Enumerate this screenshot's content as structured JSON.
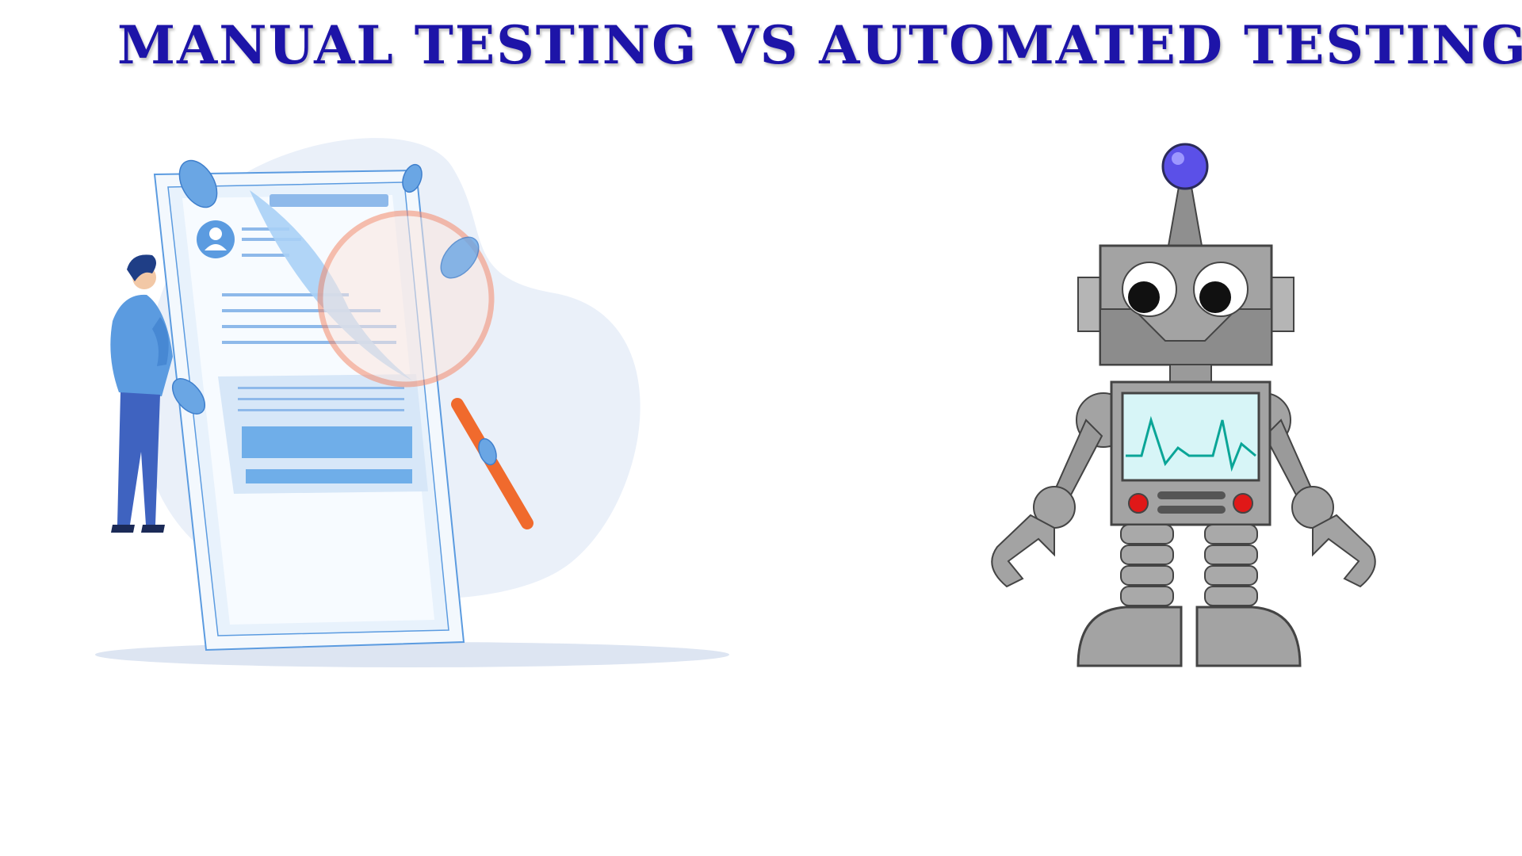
{
  "title": "MANUAL TESTING VS AUTOMATED TESTING",
  "colors": {
    "title": "#1d14a8",
    "manual_blue": "#5b9be0",
    "magnifier_orange": "#f06a2d",
    "robot_gray": "#9e9e9e",
    "robot_antenna_ball": "#5b50e8",
    "robot_screen": "#d7f5f7",
    "robot_heartbeat": "#0aa597",
    "robot_buttons": "#e01818"
  },
  "illustrations": {
    "left": {
      "icon": "manual-tester-icon",
      "depicts": [
        "person-icon",
        "document-icon",
        "magnifying-glass-icon",
        "bug-icon"
      ]
    },
    "right": {
      "icon": "robot-icon",
      "depicts": [
        "antenna-icon",
        "heartbeat-monitor-icon",
        "wrench-hand-icon"
      ]
    }
  }
}
